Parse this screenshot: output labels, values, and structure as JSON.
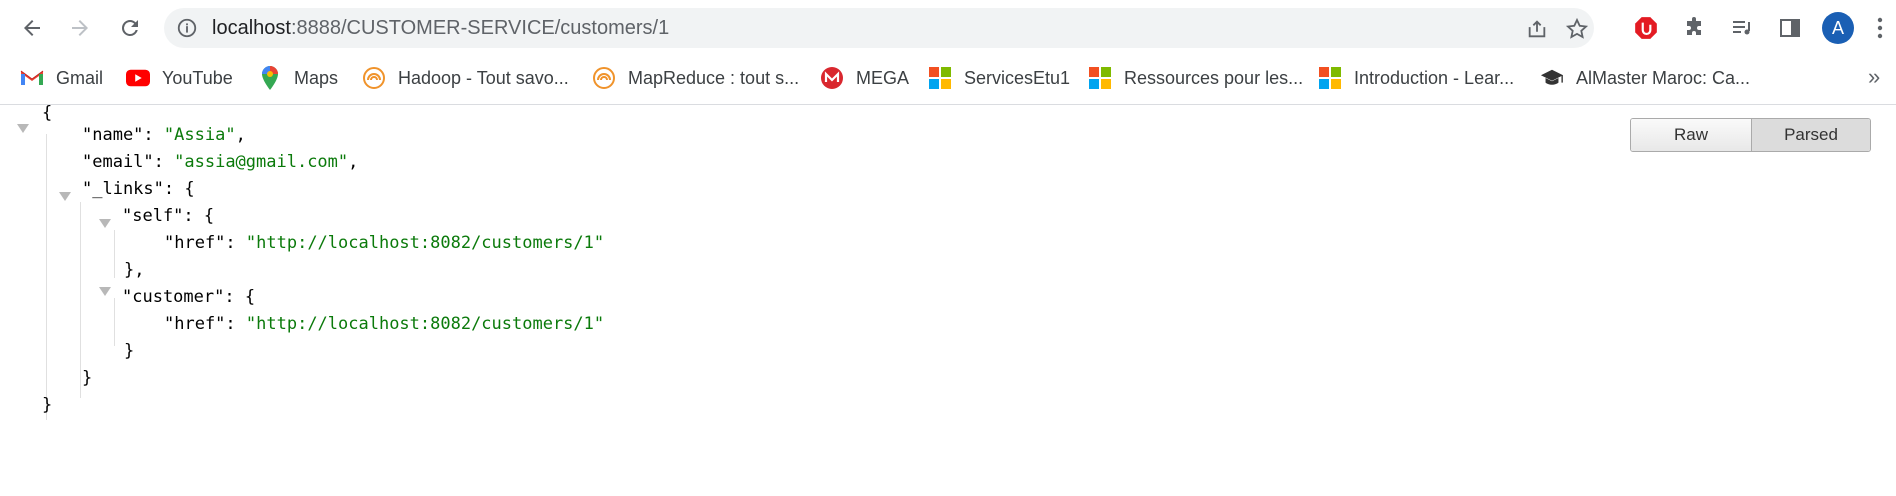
{
  "browser": {
    "url_host": "localhost",
    "url_path": ":8888/CUSTOMER-SERVICE/customers/1",
    "avatar_letter": "A"
  },
  "bookmarks": [
    {
      "label": "Gmail",
      "icon": "gmail-icon"
    },
    {
      "label": "YouTube",
      "icon": "youtube-icon"
    },
    {
      "label": "Maps",
      "icon": "maps-icon"
    },
    {
      "label": "Hadoop - Tout savo...",
      "icon": "hadoop-icon"
    },
    {
      "label": "MapReduce : tout s...",
      "icon": "mapreduce-icon"
    },
    {
      "label": "MEGA",
      "icon": "mega-icon"
    },
    {
      "label": "ServicesEtu1",
      "icon": "microsoft-icon"
    },
    {
      "label": "Ressources pour les...",
      "icon": "microsoft-icon"
    },
    {
      "label": "Introduction - Lear...",
      "icon": "microsoft-icon"
    },
    {
      "label": "AlMaster Maroc: Ca...",
      "icon": "graduation-cap-icon"
    }
  ],
  "viewer": {
    "raw_label": "Raw",
    "parsed_label": "Parsed",
    "json": {
      "open_brace": "{",
      "name_key": "\"name\"",
      "name_value": "\"Assia\"",
      "email_key": "\"email\"",
      "email_value": "\"assia@gmail.com\"",
      "links_key": "\"_links\"",
      "self_key": "\"self\"",
      "href_key": "\"href\"",
      "self_href": "\"http://localhost:8082/customers/1\"",
      "customer_key": "\"customer\"",
      "customer_href": "\"http://localhost:8082/customers/1\"",
      "close_brace": "}"
    }
  }
}
